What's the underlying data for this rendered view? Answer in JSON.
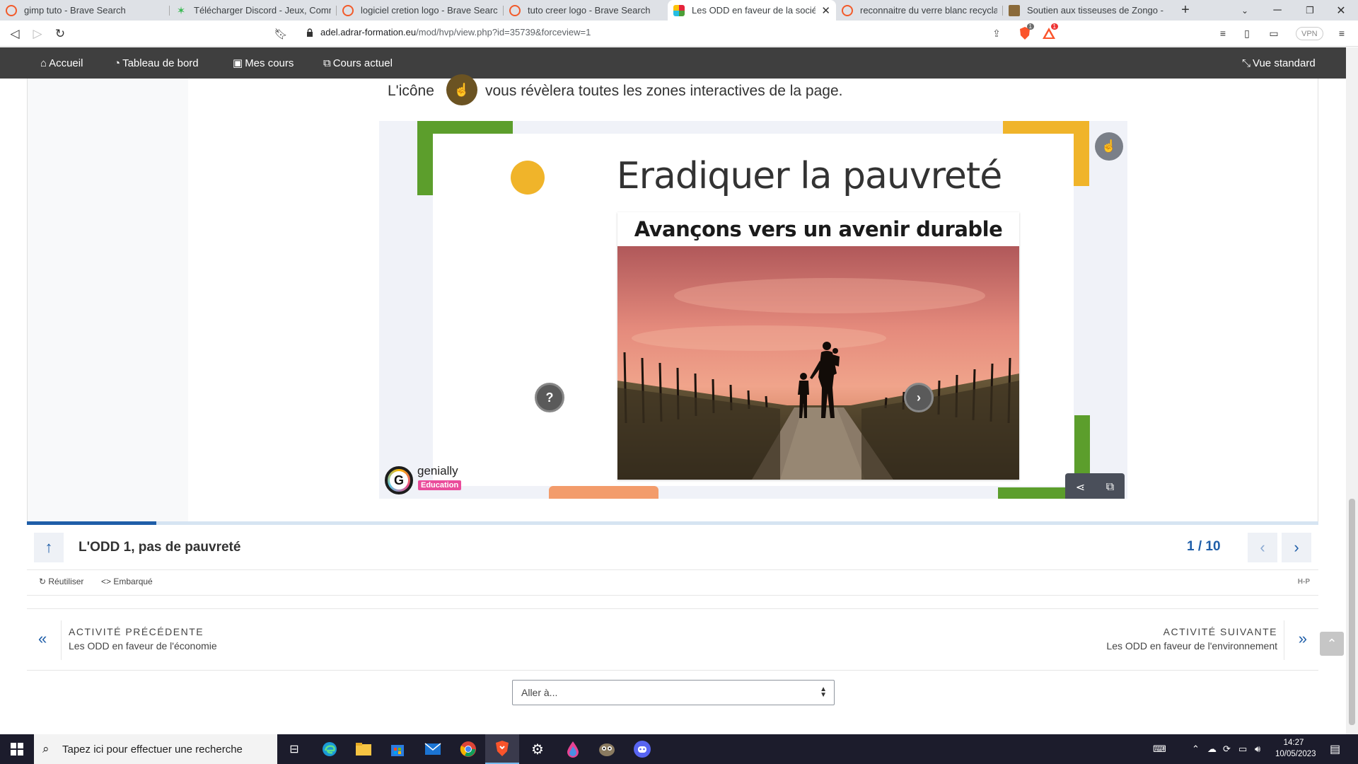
{
  "browser": {
    "tabs": [
      {
        "title": "gimp tuto - Brave Search",
        "icon": "brave-search-icon"
      },
      {
        "title": "Télécharger Discord - Jeux, Communi",
        "icon": "download-star-icon"
      },
      {
        "title": "logiciel cretion logo - Brave Search",
        "icon": "brave-search-icon"
      },
      {
        "title": "tuto creer logo - Brave Search",
        "icon": "brave-search-icon"
      },
      {
        "title": "Les ODD en faveur de la société",
        "icon": "moodle-icon",
        "active": true
      },
      {
        "title": "reconnaitre du verre blanc recyclage",
        "icon": "brave-search-icon"
      },
      {
        "title": "Soutien aux tisseuses de Zongo - Art",
        "icon": "page-icon"
      }
    ],
    "url_host": "adel.adrar-formation.eu",
    "url_path": "/mod/hvp/view.php?id=35739&forceview=1",
    "vpn_label": "VPN",
    "shield_badge": "1",
    "rewards_badge": "1"
  },
  "moodle_nav": {
    "home": "Accueil",
    "dashboard": "Tableau de bord",
    "my_courses": "Mes cours",
    "current_course": "Cours actuel",
    "standard_view": "Vue standard"
  },
  "content": {
    "hint_before": "L'icône",
    "hint_after": "vous révèlera toutes les zones interactives de la page.",
    "slide_title": "Eradiquer la pauvreté",
    "photo_heading": "Avançons vers un avenir durable",
    "genially_name": "genially",
    "genially_badge": "Education",
    "help_symbol": "?",
    "colors": {
      "green": "#5c9e2c",
      "yellow": "#f0b42a",
      "orange": "#f39c6b",
      "accent": "#1f5ea8"
    }
  },
  "player": {
    "title": "L'ODD 1, pas de pauvreté",
    "counter": "1 / 10",
    "progress": 0.1,
    "reuse": "Réutiliser",
    "embed": "Embarqué",
    "hp": "H-P"
  },
  "activity_nav": {
    "prev_label": "ACTIVITÉ PRÉCÉDENTE",
    "prev_value": "Les ODD en faveur de l'économie",
    "next_label": "ACTIVITÉ SUIVANTE",
    "next_value": "Les ODD en faveur de l'environnement",
    "jump_placeholder": "Aller à..."
  },
  "taskbar": {
    "search_placeholder": "Tapez ici pour effectuer une recherche",
    "time": "14:27",
    "date": "10/05/2023"
  }
}
